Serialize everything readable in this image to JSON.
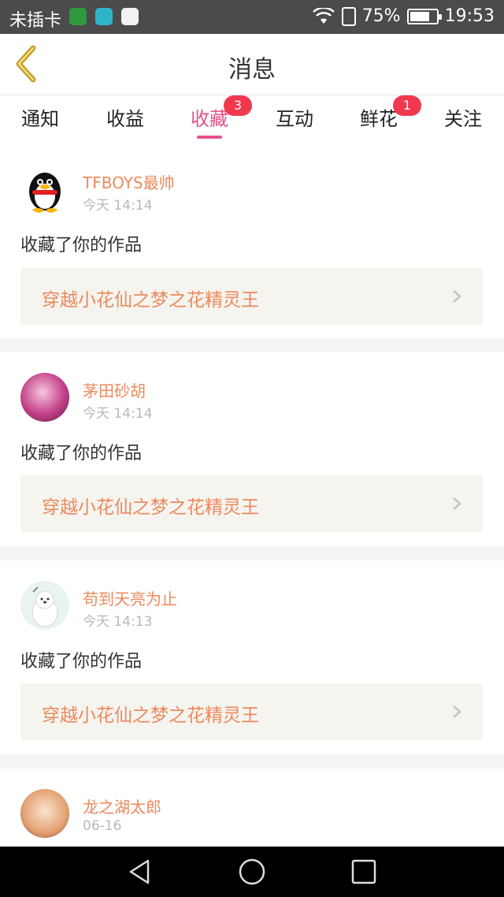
{
  "status_bar": {
    "carrier": "未插卡",
    "battery": "75%",
    "battery_level": 0.75,
    "time": "19:53",
    "icons": [
      "wifi-icon",
      "sim-icon",
      "battery-icon"
    ]
  },
  "header": {
    "title": "消息",
    "back_icon": "chevron-left-icon"
  },
  "tabs": [
    {
      "label": "通知",
      "badge": ""
    },
    {
      "label": "收益",
      "badge": ""
    },
    {
      "label": "收藏",
      "badge": "3",
      "active": true
    },
    {
      "label": "互动",
      "badge": ""
    },
    {
      "label": "鲜花",
      "badge": "1"
    },
    {
      "label": "关注",
      "badge": ""
    }
  ],
  "feed": [
    {
      "user": "TFBOYS最帅",
      "time": "今天 14:14",
      "action": "收藏了你的作品",
      "work": "穿越小花仙之梦之花精灵王"
    },
    {
      "user": "茅田砂胡",
      "time": "今天 14:14",
      "action": "收藏了你的作品",
      "work": "穿越小花仙之梦之花精灵王"
    },
    {
      "user": "苟到天亮为止",
      "time": "今天 14:13",
      "action": "收藏了你的作品",
      "work": "穿越小花仙之梦之花精灵王"
    },
    {
      "user": "龙之湖太郎",
      "time": "06-16",
      "action": "",
      "work": ""
    }
  ],
  "colors": {
    "accent": "#e5508c",
    "username": "#ec8a5c",
    "badge": "#f0384f",
    "back_arrow": "#c9a32a"
  }
}
